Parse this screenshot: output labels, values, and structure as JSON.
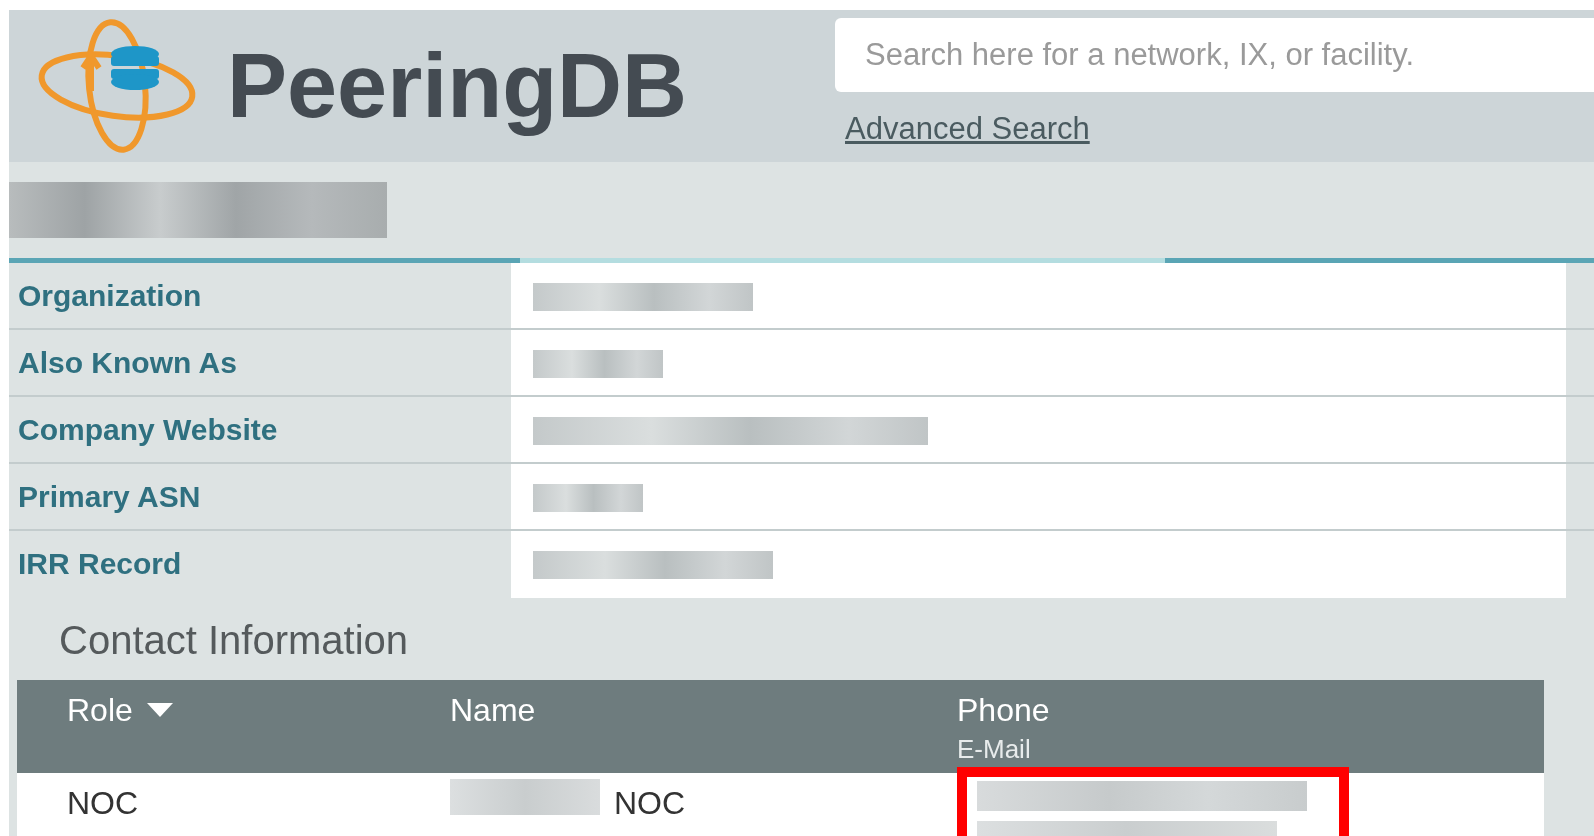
{
  "header": {
    "logo_text": "PeeringDB",
    "search": {
      "placeholder": "Search here for a network, IX, or facility."
    },
    "advanced_search": "Advanced Search"
  },
  "fields": [
    {
      "label": "Organization"
    },
    {
      "label": "Also Known As"
    },
    {
      "label": "Company Website"
    },
    {
      "label": "Primary ASN"
    },
    {
      "label": "IRR Record"
    }
  ],
  "contacts": {
    "title": "Contact Information",
    "columns": [
      {
        "label": "Role",
        "sorted": true
      },
      {
        "label": "Name",
        "sorted": false
      },
      {
        "label": "Phone",
        "sub_label": "E-Mail",
        "sorted": false
      }
    ],
    "rows": [
      {
        "role": "NOC",
        "name_suffix": "NOC",
        "highlighted": true
      }
    ]
  }
}
